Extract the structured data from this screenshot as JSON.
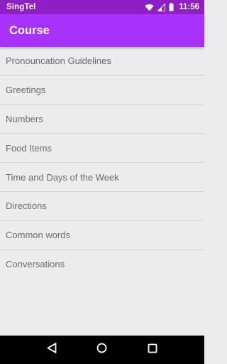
{
  "status_bar": {
    "carrier": "SingTel",
    "time": "11:56",
    "icons": [
      "wifi-icon",
      "signal-icon",
      "battery-icon"
    ]
  },
  "app_bar": {
    "title": "Course"
  },
  "course_list": [
    {
      "label": "Pronouncation Guidelines"
    },
    {
      "label": "Greetings"
    },
    {
      "label": "Numbers"
    },
    {
      "label": "Food Items"
    },
    {
      "label": "Time and Days of the Week"
    },
    {
      "label": "Directions"
    },
    {
      "label": "Common words"
    },
    {
      "label": "Conversations"
    }
  ],
  "nav_bar": {
    "icons": [
      "back-icon",
      "home-icon",
      "recents-icon"
    ]
  },
  "colors": {
    "status_bar": "#8e1fc4",
    "app_bar": "#a632fc",
    "background": "#ececee",
    "list_text": "#6b6b6b"
  }
}
